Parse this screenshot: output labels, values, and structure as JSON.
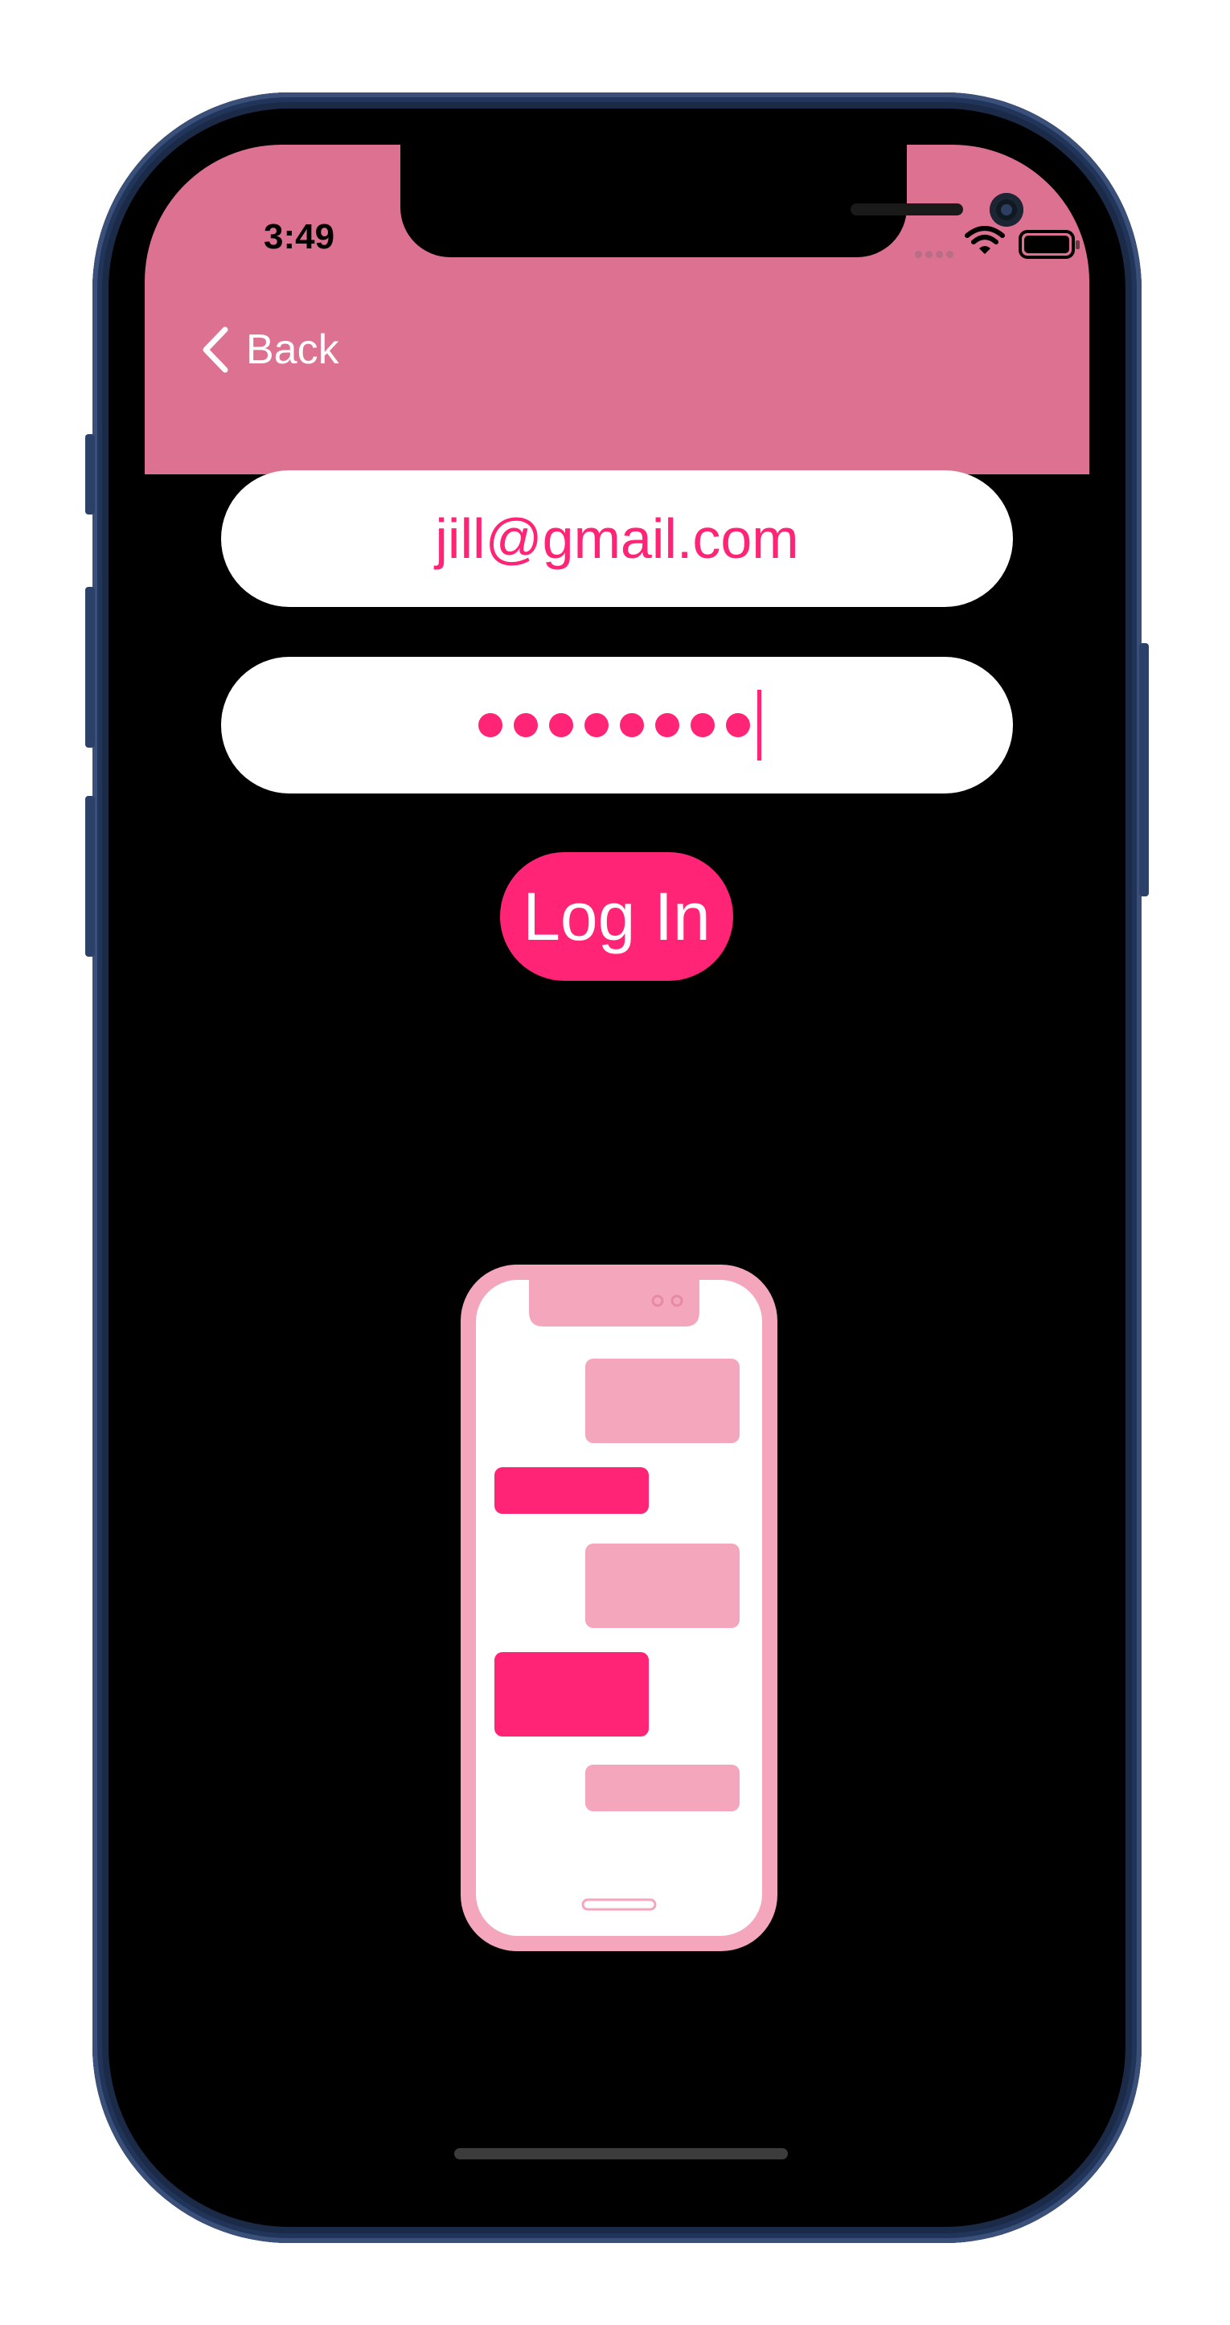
{
  "status_bar": {
    "time": "3:49"
  },
  "nav": {
    "back_label": "Back"
  },
  "form": {
    "email_value": "jill@gmail.com",
    "password_length": 8
  },
  "login_button": {
    "label": "Log In"
  },
  "colors": {
    "header": "#dc7191",
    "accent": "#ff2476",
    "background": "#000000",
    "field": "#ffffff"
  },
  "icons": [
    "chevron-left-icon",
    "wifi-icon",
    "battery-icon",
    "signal-icon",
    "chat-phone-illustration"
  ]
}
